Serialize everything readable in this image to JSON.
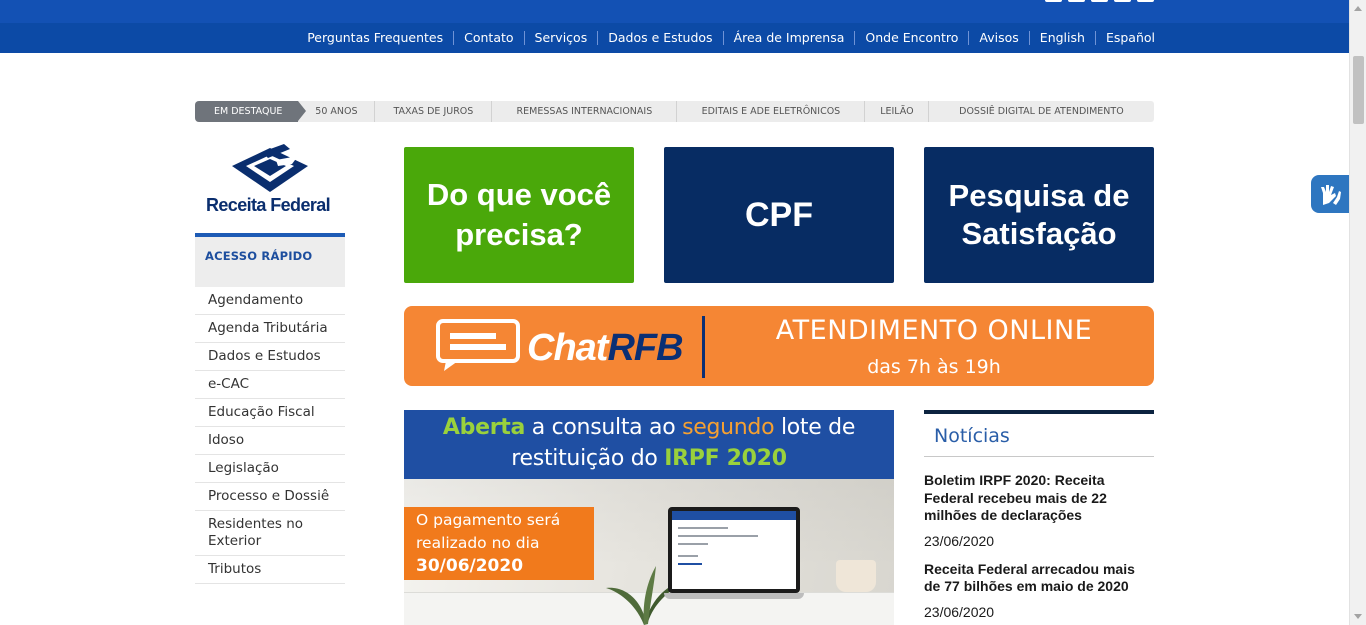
{
  "top_nav": {
    "items": [
      "Perguntas Frequentes",
      "Contato",
      "Serviços",
      "Dados e Estudos",
      "Área de Imprensa",
      "Onde Encontro",
      "Avisos",
      "English",
      "Español"
    ]
  },
  "highlights": {
    "tag": "EM DESTAQUE",
    "items": [
      "50 ANOS",
      "TAXAS DE JUROS",
      "REMESSAS INTERNACIONAIS",
      "EDITAIS E ADE ELETRÔNICOS",
      "LEILÃO",
      "DOSSIÊ DIGITAL DE ATENDIMENTO"
    ]
  },
  "logo": {
    "text": "Receita Federal"
  },
  "quick_access": {
    "title": "ACESSO RÁPIDO",
    "items": [
      "Agendamento",
      "Agenda Tributária",
      "Dados e Estudos",
      "e-CAC",
      "Educação Fiscal",
      "Idoso",
      "Legislação",
      "Processo e Dossiê",
      "Residentes no Exterior",
      "Tributos"
    ]
  },
  "tiles": {
    "need": "Do que você precisa?",
    "cpf": "CPF",
    "survey": "Pesquisa de Satisfação"
  },
  "chat_banner": {
    "brand_white": "Chat",
    "brand_blue": "RFB",
    "headline": "ATENDIMENTO ONLINE",
    "hours": "das 7h às 19h"
  },
  "irpf_banner": {
    "w1": "Aberta",
    "w2": " a consulta ao ",
    "w3": "segundo",
    "w4": " lote de",
    "w5": "restituição do ",
    "w6": "IRPF 2020",
    "pay_line1": "O pagamento será",
    "pay_line2": "realizado no dia",
    "pay_date": "30/06/2020"
  },
  "news": {
    "title": "Notícias",
    "items": [
      {
        "headline": "Boletim IRPF 2020: Receita Federal recebeu mais de 22 milhões de declarações",
        "date": "23/06/2020"
      },
      {
        "headline": "Receita Federal arrecadou mais de 77 bilhões em maio de 2020",
        "date": "23/06/2020"
      }
    ]
  },
  "colors": {
    "top_bar": "#1351b4",
    "nav_bar": "#0c4aa6",
    "green_tile": "#4aa80a",
    "navy_tile": "#072c63",
    "chat_orange": "#f58634"
  },
  "icons": [
    "receita-logo-icon",
    "chat-window-icon",
    "vlibras-hands-icon"
  ]
}
